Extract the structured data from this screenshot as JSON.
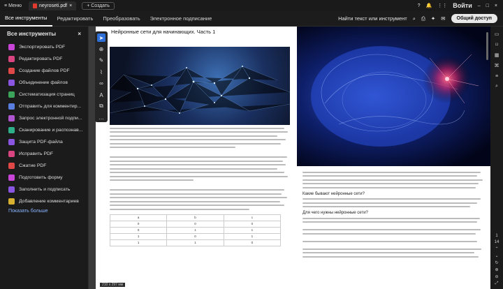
{
  "topbar": {
    "menu": "Меню",
    "tab_title": "neyroseti.pdf",
    "new_label": "Создать",
    "signin": "Войти"
  },
  "toolbar": {
    "tabs": [
      "Все инструменты",
      "Редактировать",
      "Преобразовать",
      "Электронное подписание"
    ],
    "search": "Найти текст или инструмент",
    "share": "Общий доступ"
  },
  "sidebar": {
    "title": "Все инструменты",
    "items": [
      {
        "label": "Экспортировать PDF",
        "color": "#c845d8"
      },
      {
        "label": "Редактировать PDF",
        "color": "#d84580"
      },
      {
        "label": "Создание файлов PDF",
        "color": "#e04848"
      },
      {
        "label": "Объединение файлов",
        "color": "#8a55e0"
      },
      {
        "label": "Систематизация страниц",
        "color": "#3ca35a"
      },
      {
        "label": "Отправить для комментир...",
        "color": "#5a7de0"
      },
      {
        "label": "Запрос электронной подпи...",
        "color": "#b055d0"
      },
      {
        "label": "Сканирование и распознав...",
        "color": "#2fae8a"
      },
      {
        "label": "Защита PDF-файла",
        "color": "#8a55e0"
      },
      {
        "label": "Исправить PDF",
        "color": "#d84580"
      },
      {
        "label": "Сжатие PDF",
        "color": "#e04848"
      },
      {
        "label": "Подготовить форму",
        "color": "#c845d8"
      },
      {
        "label": "Заполнить и подписать",
        "color": "#8a55e0"
      },
      {
        "label": "Добавление комментариев",
        "color": "#d8b030"
      }
    ],
    "more": "Показать больше"
  },
  "doc": {
    "title": "Нейронные сети для начинающих. Часть 1",
    "h_what": "Какие бывают нейронные сети?",
    "h_why": "Для чего нужны нейронные сети?",
    "table": {
      "headers": [
        "a",
        "b",
        "c"
      ],
      "rows": [
        [
          "0",
          "0",
          "0"
        ],
        [
          "0",
          "1",
          "1"
        ],
        [
          "1",
          "0",
          "1"
        ],
        [
          "1",
          "1",
          "0"
        ]
      ]
    },
    "page_size": "210 x 297 мм"
  },
  "rightrail": {
    "page_current": "1",
    "page_total": "14"
  }
}
